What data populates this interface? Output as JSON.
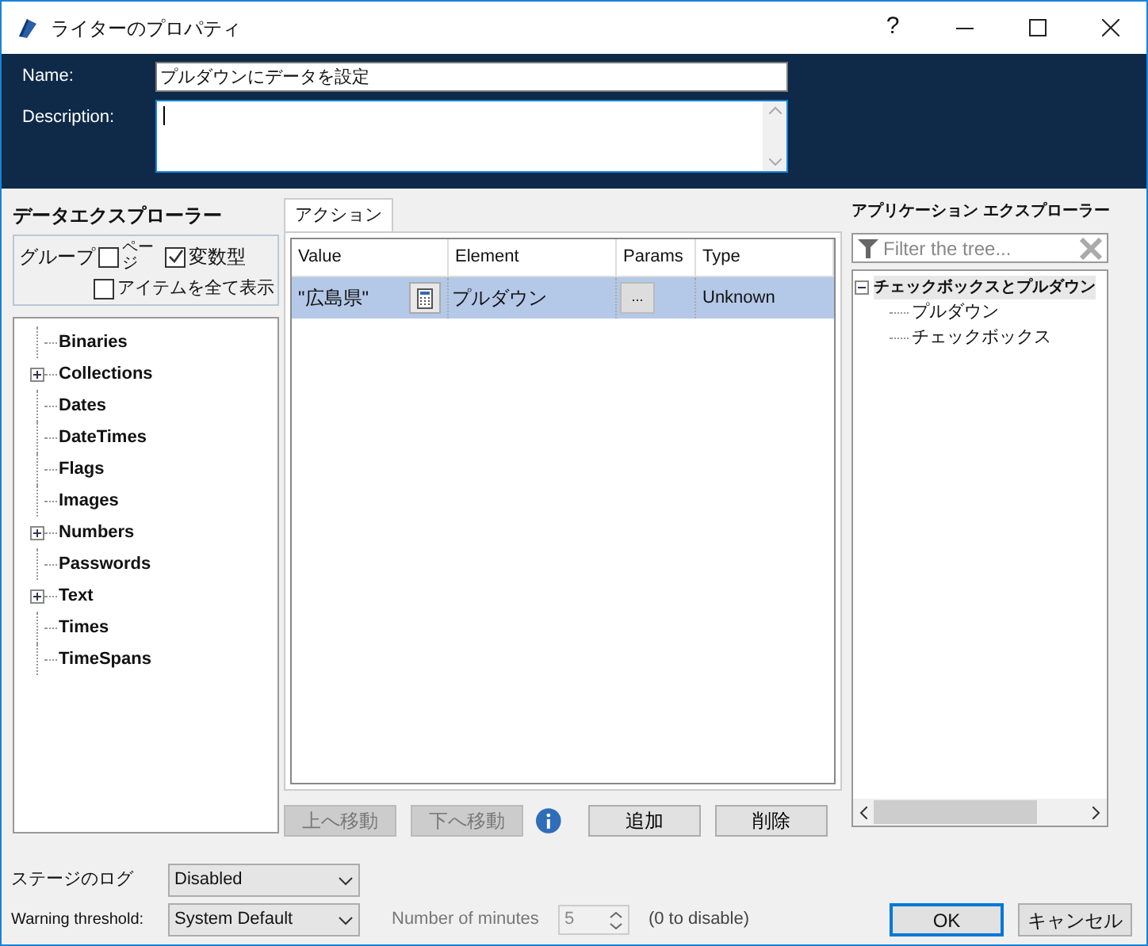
{
  "window": {
    "title": "ライターのプロパティ",
    "help": "?"
  },
  "name_field": {
    "label": "Name:",
    "value": "プルダウンにデータを設定"
  },
  "description_field": {
    "label": "Description:"
  },
  "data_explorer": {
    "title": "データエクスプローラー",
    "group_label": "グループ",
    "options": [
      {
        "label": "ページ",
        "checked": false
      },
      {
        "label": "変数型",
        "checked": true
      },
      {
        "label": "アイテムを全て表示",
        "checked": false
      }
    ],
    "tree": [
      {
        "label": "Binaries",
        "has_children": false
      },
      {
        "label": "Collections",
        "has_children": true
      },
      {
        "label": "Dates",
        "has_children": false
      },
      {
        "label": "DateTimes",
        "has_children": false
      },
      {
        "label": "Flags",
        "has_children": false
      },
      {
        "label": "Images",
        "has_children": false
      },
      {
        "label": "Numbers",
        "has_children": true
      },
      {
        "label": "Passwords",
        "has_children": false
      },
      {
        "label": "Text",
        "has_children": true
      },
      {
        "label": "Times",
        "has_children": false
      },
      {
        "label": "TimeSpans",
        "has_children": false
      }
    ]
  },
  "actions": {
    "tabs": [
      {
        "label": "アクション",
        "selected": true
      }
    ],
    "columns": [
      "Value",
      "Element",
      "Params",
      "Type"
    ],
    "rows": [
      {
        "value": "\"広島県\"",
        "element": "プルダウン",
        "params": "...",
        "type": "Unknown",
        "selected": true
      }
    ],
    "move_buttons": [
      {
        "label": "上へ移動",
        "disabled": true
      },
      {
        "label": "下へ移動",
        "disabled": true
      }
    ],
    "edit_buttons": [
      {
        "label": "追加",
        "disabled": false
      },
      {
        "label": "削除",
        "disabled": false
      }
    ]
  },
  "app_explorer": {
    "title": "アプリケーション エクスプローラー",
    "filter": {
      "placeholder": "Filter the tree..."
    },
    "tree": [
      {
        "label": "チェックボックスとプルダウン",
        "expanded": true,
        "selected": true,
        "children": [
          {
            "label": "プルダウン",
            "selected": false
          },
          {
            "label": "チェックボックス",
            "selected": false
          }
        ]
      }
    ]
  },
  "stage_log": {
    "label": "ステージのログ",
    "value": "Disabled"
  },
  "warning_threshold": {
    "label": "Warning threshold:",
    "value": "System Default"
  },
  "minutes": {
    "label": "Number of minutes",
    "value": "5",
    "disabled": true,
    "hint": "(0 to disable)"
  },
  "dialog_buttons": [
    {
      "label": "OK",
      "default": true
    },
    {
      "label": "キャンセル",
      "default": false
    }
  ]
}
